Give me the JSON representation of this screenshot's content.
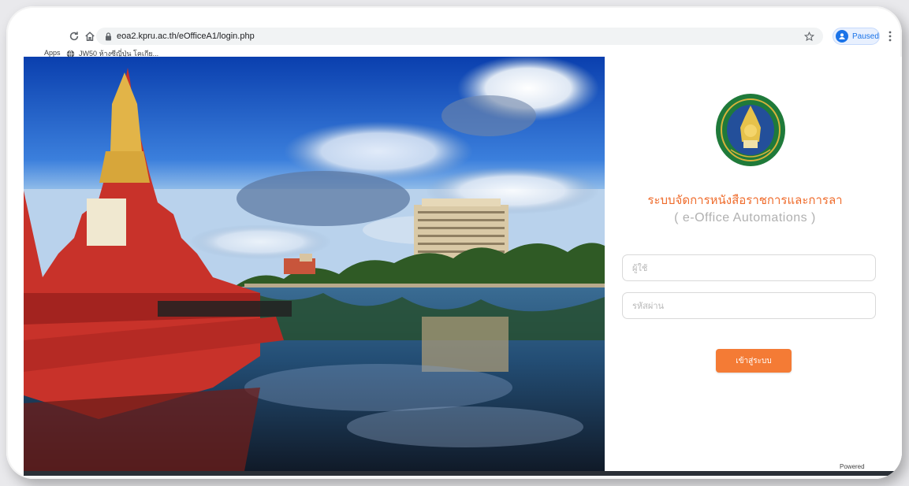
{
  "browser": {
    "url": "eoa2.kpru.ac.th/eOfficeA1/login.php",
    "profile_status": "Paused",
    "bookmarks": {
      "apps_label": "Apps",
      "items": [
        {
          "label": "JW50 ห้างซีญี่ปุ่น โคเกีย..."
        }
      ]
    },
    "icons": {
      "reload": "reload-icon",
      "home": "home-icon",
      "lock": "lock-icon",
      "star": "star-icon",
      "menu": "menu-icon"
    }
  },
  "login": {
    "title": "ระบบจัดการหนังสือราชการและการลา",
    "subtitle": "( e-Office Automations )",
    "username_placeholder": "ผู้ใช้",
    "password_placeholder": "รหัสผ่าน",
    "submit_label": "เข้าสู่ระบบ",
    "footer": "Powered",
    "accent_color": "#f47b35",
    "title_color": "#ef6b2b"
  }
}
